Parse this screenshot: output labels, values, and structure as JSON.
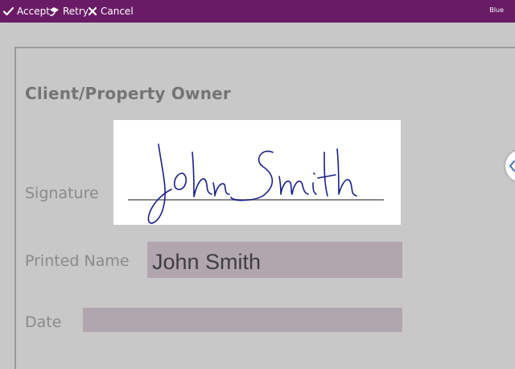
{
  "toolbar": {
    "accept_label": "Accept",
    "retry_label": "Retry",
    "cancel_label": "Cancel",
    "pen_color_label": "Blue"
  },
  "form": {
    "section_title": "Client/Property Owner",
    "signature_label": "Signature",
    "printed_name_label": "Printed Name",
    "printed_name_value": "John Smith",
    "date_label": "Date"
  },
  "signature": {
    "ink_color": "#1a1f8c",
    "signed_text": "John Smith"
  },
  "colors": {
    "toolbar_bg": "#6a1b66",
    "page_bg": "#c8c8c8",
    "field_bg": "#b2a6ae",
    "handle_arrow": "#2a6fb0"
  },
  "icons": {
    "accept": "checkmark-icon",
    "retry": "eraser-icon",
    "cancel": "close-icon",
    "drawer": "chevron-left-icon"
  }
}
